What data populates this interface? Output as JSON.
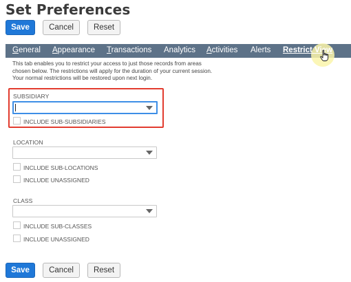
{
  "page": {
    "title": "Set Preferences"
  },
  "top_actions": {
    "save": "Save",
    "cancel": "Cancel",
    "reset": "Reset"
  },
  "tabs": [
    {
      "label": "General",
      "underline": "G",
      "rest": "eneral"
    },
    {
      "label": "Appearance",
      "underline": "A",
      "rest": "ppearance"
    },
    {
      "label": "Transactions",
      "underline": "T",
      "rest": "ransactions"
    },
    {
      "label": "Analytics",
      "underline": "",
      "rest": "Analytics"
    },
    {
      "label": "Activities",
      "underline": "A",
      "rest": "ctivities"
    },
    {
      "label": "Alerts",
      "underline": "",
      "rest": "Alerts"
    },
    {
      "label": "Restrict View",
      "underline": "Restrict View",
      "rest": ""
    }
  ],
  "description": [
    "This tab enables you to restrict your access to just those records from areas",
    "chosen below. The restrictions will apply for the duration of your current session.",
    "Your normal restrictions will be restored upon next login."
  ],
  "subsidiary": {
    "label": "SUBSIDIARY",
    "value": "",
    "include_sub": "INCLUDE SUB-SUBSIDIARIES"
  },
  "location": {
    "label": "LOCATION",
    "value": "",
    "include_sub": "INCLUDE SUB-LOCATIONS",
    "include_unassigned": "INCLUDE UNASSIGNED"
  },
  "class": {
    "label": "CLASS",
    "value": "",
    "include_sub": "INCLUDE SUB-CLASSES",
    "include_unassigned": "INCLUDE UNASSIGNED"
  },
  "bottom_actions": {
    "save": "Save",
    "cancel": "Cancel",
    "reset": "Reset"
  },
  "colors": {
    "primary_button": "#1f78d8",
    "tab_bar": "#5d7288",
    "highlight_box": "#e23b2e",
    "focus_border": "#3d8ee6"
  },
  "icons": {
    "cursor": "hand-pointer-icon",
    "dropdown": "chevron-down-icon"
  }
}
